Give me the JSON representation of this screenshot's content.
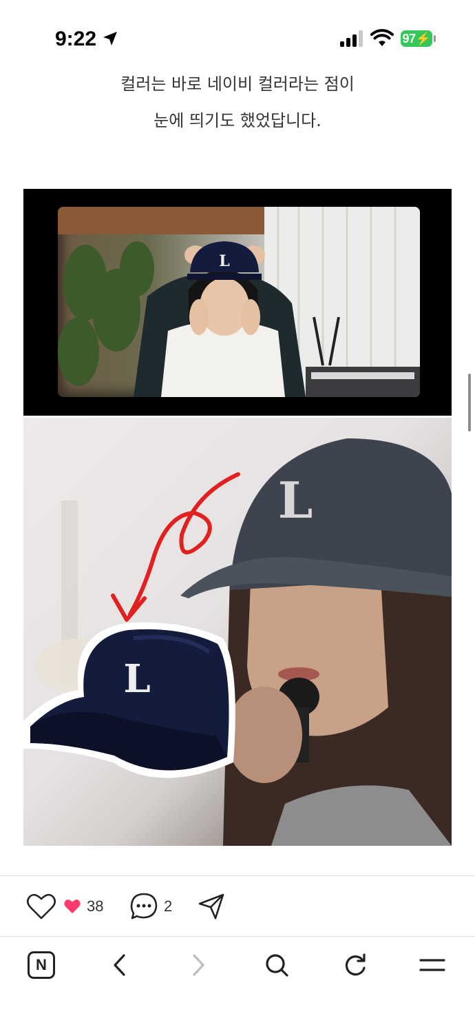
{
  "status_bar": {
    "time": "9:22",
    "battery_level": "97"
  },
  "article": {
    "text_lines": [
      "컬러는 바로 네이비 컬러라는 점이",
      "눈에 띄기도 했었답니다."
    ]
  },
  "photos": {
    "cap_logo_letter": "L"
  },
  "action_bar": {
    "likes_count": "38",
    "comments_count": "2"
  },
  "toolbar": {
    "naver_label": "N"
  },
  "colors": {
    "battery": "#34c759",
    "like_heart": "#ff3b6b",
    "annotation_arrow": "#e0211f",
    "cap_navy": "#141c3e"
  }
}
